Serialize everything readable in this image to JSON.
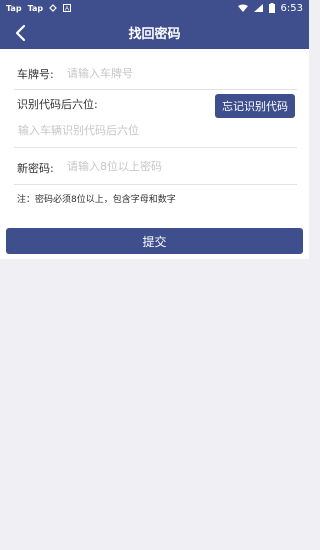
{
  "status_bar": {
    "left_items": [
      "Tap",
      "Tap"
    ],
    "time": "6:53",
    "icons": [
      "sync-icon",
      "a-icon",
      "wifi-icon",
      "signal-icon",
      "battery-icon"
    ]
  },
  "app_bar": {
    "title": "找回密码",
    "back_icon": "chevron-left-icon"
  },
  "form": {
    "plate_label": "车牌号:",
    "plate_placeholder": "请输入车牌号",
    "vin_label": "识别代码后六位:",
    "forgot_vin_button": "忘记识别代码",
    "vin_placeholder": "输入车辆识别代码后六位",
    "password_label": "新密码:",
    "password_placeholder": "请输入8位以上密码",
    "note": "注：密码必须8位以上，包含字母和数字"
  },
  "submit_label": "提交",
  "colors": {
    "primary": "#3f4f8e",
    "background": "#efeff4",
    "divider": "#e1e1e6",
    "placeholder": "#c6c6c9"
  }
}
